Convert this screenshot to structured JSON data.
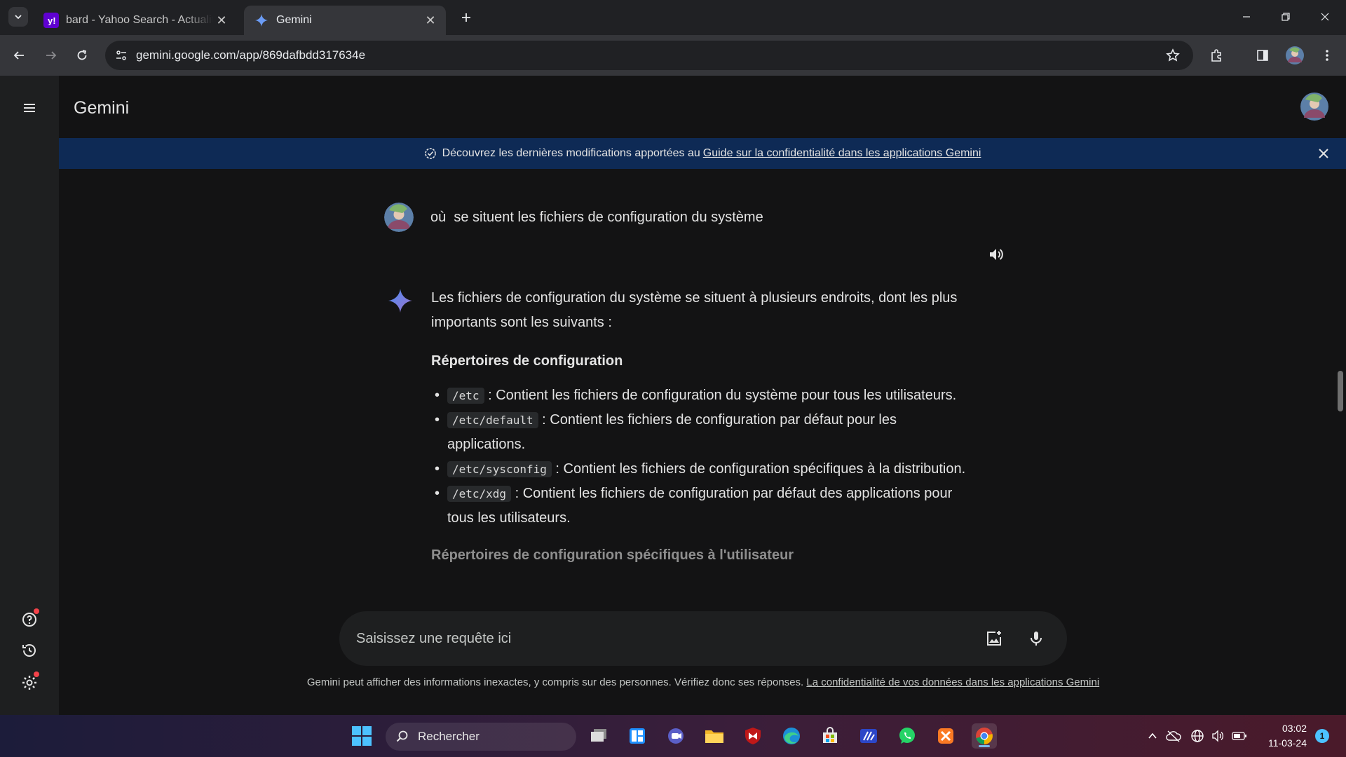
{
  "browser": {
    "tabs": [
      {
        "title": "bard - Yahoo Search - Actualités",
        "favicon": "yahoo-icon",
        "active": false
      },
      {
        "title": "Gemini",
        "favicon": "gemini-spark-icon",
        "active": true
      }
    ],
    "url": "gemini.google.com/app/869dafbdd317634e"
  },
  "app": {
    "brand": "Gemini",
    "banner": {
      "text": "Découvrez les dernières modifications apportées au",
      "link": "Guide sur la confidentialité dans les applications Gemini"
    },
    "prompt": "où  se situent les fichiers de configuration du système",
    "answer": {
      "intro": "Les fichiers de configuration du système se situent à plusieurs endroits, dont les plus importants sont les suivants :",
      "heading1": "Répertoires de configuration",
      "items": [
        {
          "code": "/etc",
          "text": " : Contient les fichiers de configuration du système pour tous les utilisateurs."
        },
        {
          "code": "/etc/default",
          "text": " : Contient les fichiers de configuration par défaut pour les applications."
        },
        {
          "code": "/etc/sysconfig",
          "text": " : Contient les fichiers de configuration spécifiques à la distribution."
        },
        {
          "code": "/etc/xdg",
          "text": " : Contient les fichiers de configuration par défaut des applications pour tous les utilisateurs."
        }
      ],
      "heading2": "Répertoires de configuration spécifiques à l'utilisateur"
    },
    "input_placeholder": "Saisissez une requête ici",
    "disclaimer": {
      "text": "Gemini peut afficher des informations inexactes, y compris sur des personnes. Vérifiez donc ses réponses.",
      "link": "La confidentialité de vos données dans les applications Gemini"
    }
  },
  "taskbar": {
    "search_label": "Rechercher",
    "time": "03:02",
    "date": "11-03-24",
    "notifications": "1"
  },
  "colors": {
    "background": "#131314",
    "banner": "#0e2a55",
    "accent": "#4285f4"
  }
}
